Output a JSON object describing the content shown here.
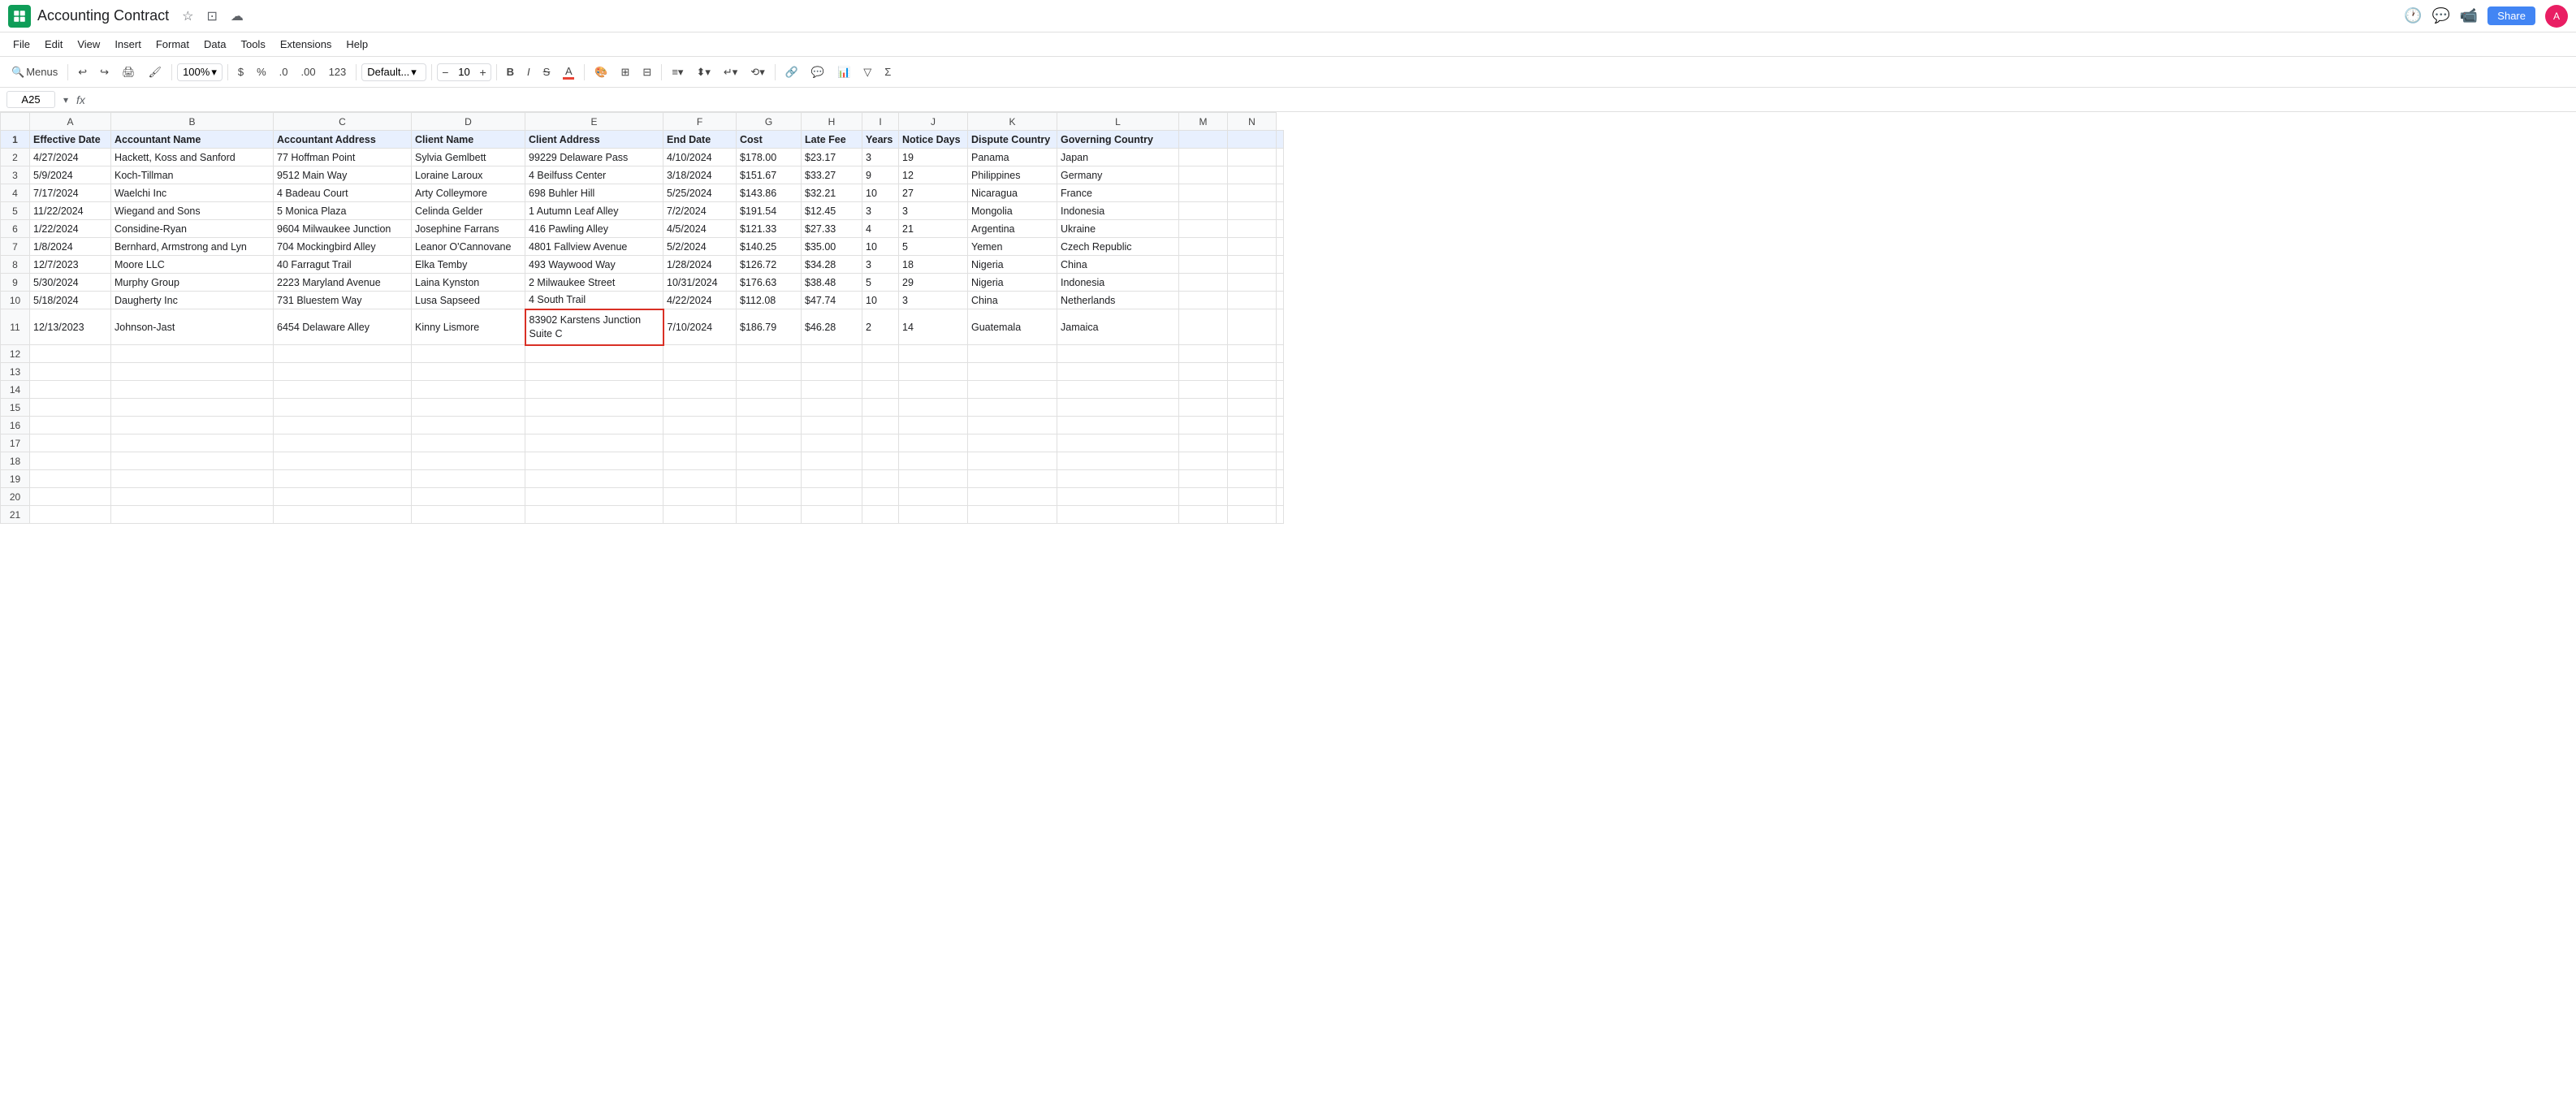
{
  "app": {
    "title": "Accounting Contract",
    "icon_color": "#0f9d58"
  },
  "menu": {
    "items": [
      "File",
      "Edit",
      "View",
      "Insert",
      "Format",
      "Data",
      "Tools",
      "Extensions",
      "Help"
    ]
  },
  "toolbar": {
    "search_label": "Menus",
    "zoom": "100%",
    "currency": "$",
    "percent": "%",
    "decimal_decrease": ".0",
    "decimal_increase": ".00",
    "format_123": "123",
    "font": "Default...",
    "font_size": "10",
    "bold": "B",
    "italic": "I",
    "strikethrough": "S"
  },
  "formula_bar": {
    "cell_ref": "A25",
    "fx_label": "fx"
  },
  "columns": {
    "headers": [
      "",
      "A",
      "B",
      "C",
      "D",
      "E",
      "F",
      "G",
      "H",
      "I",
      "J",
      "K",
      "L",
      "M",
      "N"
    ],
    "widths": [
      36,
      100,
      200,
      170,
      140,
      170,
      90,
      80,
      75,
      45,
      85,
      110,
      150,
      60,
      60
    ]
  },
  "rows": [
    {
      "row": 1,
      "cells": [
        "Effective Date",
        "Accountant Name",
        "Accountant Address",
        "Client Name",
        "Client Address",
        "End Date",
        "Cost",
        "Late Fee",
        "Years",
        "Notice Days",
        "Dispute Country",
        "Governing Country"
      ]
    },
    {
      "row": 2,
      "cells": [
        "4/27/2024",
        "Hackett, Koss and Sanford",
        "77 Hoffman Point",
        "Sylvia Gemlbett",
        "99229 Delaware Pass",
        "4/10/2024",
        "$178.00",
        "$23.17",
        "3",
        "19",
        "Panama",
        "Japan"
      ]
    },
    {
      "row": 3,
      "cells": [
        "5/9/2024",
        "Koch-Tillman",
        "9512 Main Way",
        "Loraine Laroux",
        "4 Beilfuss Center",
        "3/18/2024",
        "$151.67",
        "$33.27",
        "9",
        "12",
        "Philippines",
        "Germany"
      ]
    },
    {
      "row": 4,
      "cells": [
        "7/17/2024",
        "Waelchi Inc",
        "4 Badeau Court",
        "Arty Colleymore",
        "698 Buhler Hill",
        "5/25/2024",
        "$143.86",
        "$32.21",
        "10",
        "27",
        "Nicaragua",
        "France"
      ]
    },
    {
      "row": 5,
      "cells": [
        "11/22/2024",
        "Wiegand and Sons",
        "5 Monica Plaza",
        "Celinda Gelder",
        "1 Autumn Leaf Alley",
        "7/2/2024",
        "$191.54",
        "$12.45",
        "3",
        "3",
        "Mongolia",
        "Indonesia"
      ]
    },
    {
      "row": 6,
      "cells": [
        "1/22/2024",
        "Considine-Ryan",
        "9604 Milwaukee Junction",
        "Josephine Farrans",
        "416 Pawling Alley",
        "4/5/2024",
        "$121.33",
        "$27.33",
        "4",
        "21",
        "Argentina",
        "Ukraine"
      ]
    },
    {
      "row": 7,
      "cells": [
        "1/8/2024",
        "Bernhard, Armstrong and Lyn",
        "704 Mockingbird Alley",
        "Leanor O'Cannovane",
        "4801 Fallview Avenue",
        "5/2/2024",
        "$140.25",
        "$35.00",
        "10",
        "5",
        "Yemen",
        "Czech Republic"
      ]
    },
    {
      "row": 8,
      "cells": [
        "12/7/2023",
        "Moore LLC",
        "40 Farragut Trail",
        "Elka Temby",
        "493 Waywood Way",
        "1/28/2024",
        "$126.72",
        "$34.28",
        "3",
        "18",
        "Nigeria",
        "China"
      ]
    },
    {
      "row": 9,
      "cells": [
        "5/30/2024",
        "Murphy Group",
        "2223 Maryland Avenue",
        "Laina Kynston",
        "2 Milwaukee Street",
        "10/31/2024",
        "$176.63",
        "$38.48",
        "5",
        "29",
        "Nigeria",
        "Indonesia"
      ]
    },
    {
      "row": 10,
      "cells": [
        "5/18/2024",
        "Daugherty Inc",
        "731 Bluestem Way",
        "Lusa Sapseed",
        "4 South Trail",
        "4/22/2024",
        "$112.08",
        "$47.74",
        "10",
        "3",
        "China",
        "Netherlands"
      ]
    },
    {
      "row": 11,
      "cells": [
        "12/13/2023",
        "Johnson-Jast",
        "6454 Delaware Alley",
        "Kinny Lismore",
        "83902 Karstens Junction Suite C",
        "7/10/2024",
        "$186.79",
        "$46.28",
        "2",
        "14",
        "Guatemala",
        "Jamaica"
      ]
    },
    {
      "row": 12,
      "cells": []
    },
    {
      "row": 13,
      "cells": []
    },
    {
      "row": 14,
      "cells": []
    },
    {
      "row": 15,
      "cells": []
    },
    {
      "row": 16,
      "cells": []
    },
    {
      "row": 17,
      "cells": []
    },
    {
      "row": 18,
      "cells": []
    },
    {
      "row": 19,
      "cells": []
    },
    {
      "row": 20,
      "cells": []
    },
    {
      "row": 21,
      "cells": []
    }
  ]
}
